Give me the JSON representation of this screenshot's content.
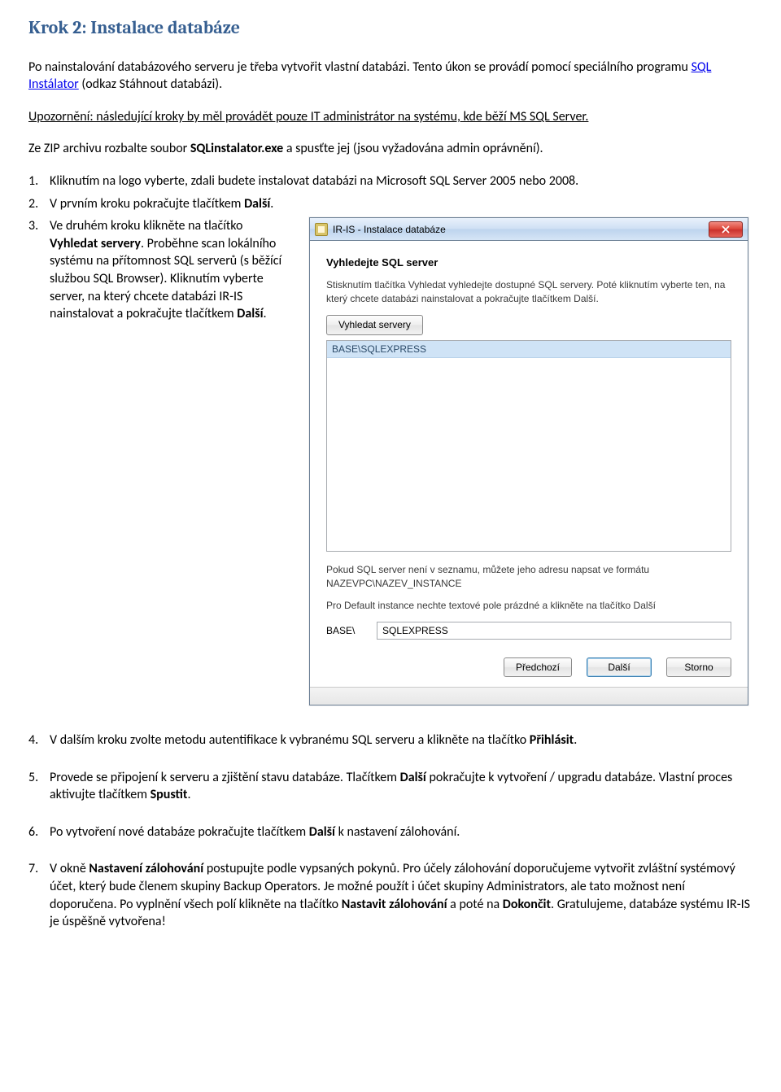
{
  "heading": "Krok 2: Instalace databáze",
  "intro": {
    "pre": "Po nainstalování databázového serveru je třeba vytvořit vlastní databázi. Tento úkon se provádí pomocí speciálního programu ",
    "link": "SQL Instálator",
    "post": " (odkaz Stáhnout databázi)."
  },
  "warning": "Upozornění: následující kroky by měl provádět pouze IT administrátor na systému, kde běží MS SQL Server.",
  "zip": {
    "pre": "Ze ZIP archivu rozbalte soubor ",
    "file": "SQLinstalator.exe",
    "post": " a spusťte jej (jsou vyžadována admin oprávnění)."
  },
  "li1": "Kliknutím na logo vyberte, zdali budete instalovat databázi na Microsoft SQL Server 2005 nebo 2008.",
  "li2": {
    "pre": "V prvním kroku pokračujte tlačítkem ",
    "btn": "Další",
    "post": "."
  },
  "li3": {
    "a": "Ve druhém kroku klikněte na tlačítko ",
    "b": "Vyhledat servery",
    "c": ". Proběhne scan lokálního systému na přítomnost SQL serverů (s běžící službou SQL Browser). Kliknutím vyberte server, na který chcete databázi IR-IS nainstalovat a pokračujte tlačítkem ",
    "d": "Další",
    "e": "."
  },
  "li4": {
    "pre": "V dalším kroku zvolte metodu autentifikace k vybranému SQL serveru a klikněte na tlačítko ",
    "btn": "Přihlásit",
    "post": "."
  },
  "li5": {
    "a": "Provede se připojení k serveru a zjištění stavu databáze. Tlačítkem ",
    "b": "Další",
    "c": " pokračujte k vytvoření / upgradu databáze. Vlastní proces aktivujte tlačítkem ",
    "d": "Spustit",
    "e": "."
  },
  "li6": {
    "a": "Po vytvoření nové databáze pokračujte tlačítkem ",
    "b": "Další",
    "c": " k nastavení zálohování."
  },
  "li7": {
    "a": "V okně ",
    "b": "Nastavení zálohování",
    "c": " postupujte podle vypsaných pokynů. Pro účely zálohování doporučujeme vytvořit zvláštní systémový účet, který bude členem skupiny Backup Operators. Je možné použít i účet skupiny Administrators, ale tato možnost není doporučena. Po vyplnění všech polí klikněte na tlačítko ",
    "d": "Nastavit zálohování",
    "e": " a poté na ",
    "f": "Dokončit",
    "g": ". Gratulujeme, databáze systému IR-IS je úspěšně vytvořena!"
  },
  "dialog": {
    "title": "IR-IS - Instalace databáze",
    "heading": "Vyhledejte SQL server",
    "desc": "Stisknutím tlačítka Vyhledat vyhledejte dostupné SQL servery. Poté kliknutím vyberte ten, na který chcete databázi nainstalovat a pokračujte tlačítkem Další.",
    "btn_search": "Vyhledat servery",
    "list_item": "BASE\\SQLEXPRESS",
    "mid": "Pokud SQL server není v seznamu, můžete jeho adresu napsat ve formátu NAZEVPC\\NAZEV_INSTANCE",
    "default_note": "Pro Default instance nechte textové pole prázdné a klikněte na tlačítko Další",
    "inst_label": "BASE\\",
    "inst_value": "SQLEXPRESS",
    "btn_prev": "Předchozí",
    "btn_next": "Další",
    "btn_cancel": "Storno"
  }
}
